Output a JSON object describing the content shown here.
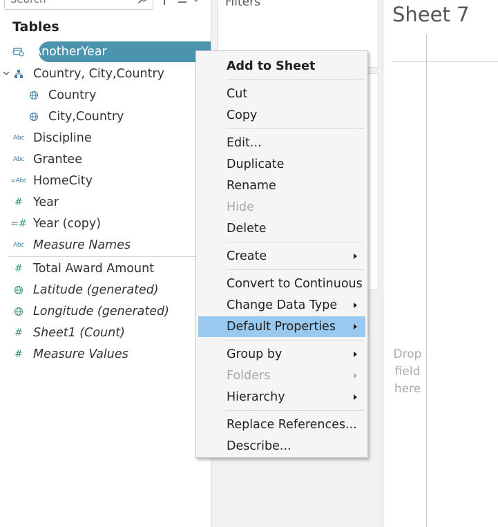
{
  "search": {
    "placeholder": "Search"
  },
  "data_pane": {
    "tables_heading": "Tables",
    "fields": [
      {
        "label": "AnotherYear",
        "icon": "calendar-link-icon",
        "selected": true,
        "italic": false
      },
      {
        "label": "Country, City,Country",
        "icon": "hierarchy-icon",
        "italic": false
      },
      {
        "label": "Country",
        "icon": "globe-icon",
        "italic": false
      },
      {
        "label": "City,Country",
        "icon": "globe-icon",
        "italic": false
      },
      {
        "label": "Discipline",
        "icon": "abc-icon",
        "icon_text": "Abc",
        "italic": false
      },
      {
        "label": "Grantee",
        "icon": "abc-icon",
        "icon_text": "Abc",
        "italic": false
      },
      {
        "label": "HomeCity",
        "icon": "calc-abc-icon",
        "icon_text": "=Abc",
        "italic": false
      },
      {
        "label": "Year",
        "icon": "hash-icon",
        "icon_text": "#",
        "italic": false
      },
      {
        "label": "Year (copy)",
        "icon": "calc-hash-icon",
        "icon_text": "=#",
        "italic": false
      },
      {
        "label": "Measure Names",
        "icon": "abc-icon",
        "icon_text": "Abc",
        "italic": true
      },
      {
        "label": "Total Award Amount",
        "icon": "hash-icon",
        "icon_text": "#",
        "italic": false
      },
      {
        "label": "Latitude (generated)",
        "icon": "globe-icon",
        "italic": true
      },
      {
        "label": "Longitude (generated)",
        "icon": "globe-icon",
        "italic": true
      },
      {
        "label": "Sheet1 (Count)",
        "icon": "hash-icon",
        "icon_text": "#",
        "italic": true
      },
      {
        "label": "Measure Values",
        "icon": "hash-icon",
        "icon_text": "#",
        "italic": true
      }
    ]
  },
  "filters": {
    "title": "Filters"
  },
  "sheet": {
    "title": "Sheet 7",
    "drop_field": [
      "Drop",
      "field",
      "here"
    ]
  },
  "context_menu": {
    "items": [
      {
        "label": "Add to Sheet",
        "bold": true
      },
      {
        "label": "Cut"
      },
      {
        "label": "Copy"
      },
      {
        "label": "Edit..."
      },
      {
        "label": "Duplicate"
      },
      {
        "label": "Rename"
      },
      {
        "label": "Hide",
        "disabled": true
      },
      {
        "label": "Delete"
      },
      {
        "label": "Create",
        "submenu": true
      },
      {
        "label": "Convert to Continuous"
      },
      {
        "label": "Change Data Type",
        "submenu": true
      },
      {
        "label": "Default Properties",
        "submenu": true,
        "highlighted": true
      },
      {
        "label": "Group by",
        "submenu": true
      },
      {
        "label": "Folders",
        "submenu": true,
        "disabled": true
      },
      {
        "label": "Hierarchy",
        "submenu": true
      },
      {
        "label": "Replace References..."
      },
      {
        "label": "Describe..."
      }
    ]
  },
  "colors": {
    "selected_pill": "#4c93ae",
    "menu_highlight": "#99c9ef",
    "dimension_icon": "#3a7fa0",
    "measure_icon": "#3a9a76",
    "menu_background": "#f5f5f5"
  }
}
